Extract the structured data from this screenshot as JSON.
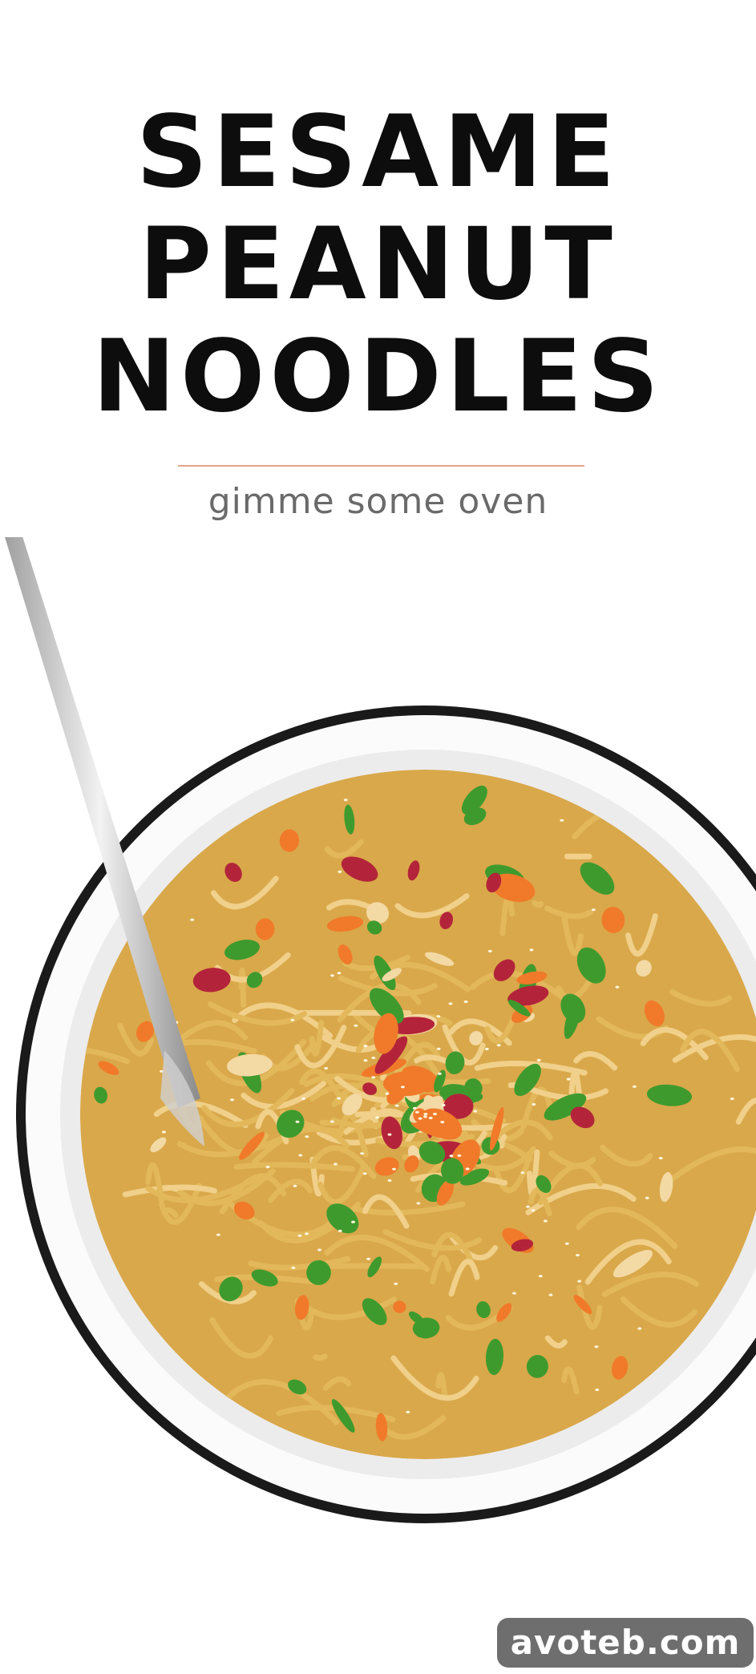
{
  "title": {
    "lines": [
      "SESAME",
      "PEANUT",
      "NOODLES"
    ]
  },
  "subtitle": "gimme some oven",
  "image": {
    "subject": "noodle-bowl-photo"
  },
  "watermark": "avoteb.com",
  "colors": {
    "background": "#ffffff",
    "title": "#0d0d0d",
    "divider": "#e0a587",
    "subtitle": "#6a6a6a",
    "bowl_rim": "#1a1a1a",
    "noodle": "#e2b85a",
    "carrot": "#f07a2a",
    "cabbage": "#b3243a",
    "herb": "#3f9a2e",
    "peanut": "#f3d9a4",
    "watermark_bg": "#6e6e6e"
  }
}
